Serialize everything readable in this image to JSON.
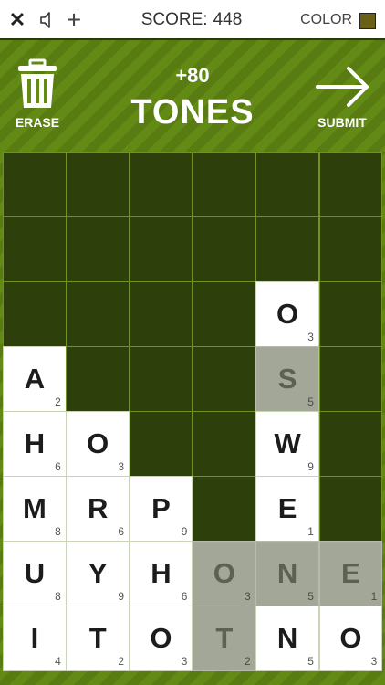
{
  "topbar": {
    "close_icon": "close-icon",
    "sound_icon": "speaker-icon",
    "add_icon": "plus-icon",
    "score_label": "SCORE:",
    "score_value": "448",
    "color_label": "COLOR",
    "color_swatch": "#6a5f17"
  },
  "header": {
    "erase_label": "ERASE",
    "points": "+80",
    "word": "TONES",
    "submit_label": "SUBMIT"
  },
  "board": {
    "columns": 6,
    "rows": [
      [
        null,
        null,
        null,
        null,
        null,
        null
      ],
      [
        null,
        null,
        null,
        null,
        null,
        null
      ],
      [
        null,
        null,
        null,
        null,
        {
          "letter": "O",
          "points": "3"
        },
        null
      ],
      [
        {
          "letter": "A",
          "points": "2"
        },
        null,
        null,
        null,
        {
          "letter": "S",
          "points": "5",
          "selected": true
        },
        null
      ],
      [
        {
          "letter": "H",
          "points": "6"
        },
        {
          "letter": "O",
          "points": "3"
        },
        null,
        null,
        {
          "letter": "W",
          "points": "9"
        },
        null
      ],
      [
        {
          "letter": "M",
          "points": "8"
        },
        {
          "letter": "R",
          "points": "6"
        },
        {
          "letter": "P",
          "points": "9"
        },
        null,
        {
          "letter": "E",
          "points": "1"
        },
        null
      ],
      [
        {
          "letter": "U",
          "points": "8"
        },
        {
          "letter": "Y",
          "points": "9"
        },
        {
          "letter": "H",
          "points": "6"
        },
        {
          "letter": "O",
          "points": "3",
          "selected": true
        },
        {
          "letter": "N",
          "points": "5",
          "selected": true
        },
        {
          "letter": "E",
          "points": "1",
          "selected": true
        }
      ],
      [
        {
          "letter": "I",
          "points": "4"
        },
        {
          "letter": "T",
          "points": "2"
        },
        {
          "letter": "O",
          "points": "3"
        },
        {
          "letter": "T",
          "points": "2",
          "selected": true
        },
        {
          "letter": "N",
          "points": "5"
        },
        {
          "letter": "O",
          "points": "3"
        }
      ]
    ]
  }
}
